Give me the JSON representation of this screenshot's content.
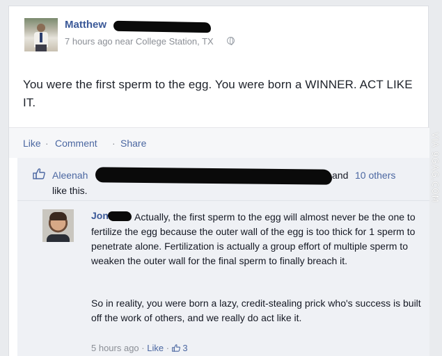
{
  "post": {
    "author": "Matthew",
    "time": "7 hours ago near College Station, TX",
    "text": "You were the first sperm to the egg. You were born a WINNER. ACT LIKE IT."
  },
  "actions": {
    "like": "Like",
    "comment": "Comment",
    "share": "Share",
    "separator": "·"
  },
  "likes": {
    "name": "Aleenah",
    "and": "and",
    "others": "10 others",
    "suffix": "like this."
  },
  "comment": {
    "author": "Jon",
    "text": "Actually, the first sperm to the egg will almost never be the one to fertilize the egg because the outer wall of the egg is too thick for 1 sperm to penetrate alone. Fertilization is actually a group effort of multiple sperm to weaken the outer wall for the final sperm to finally breach it.",
    "text2": "So in reality, you were born a lazy, credit-stealing prick who's success is built off the work of others, and we really do act like it.",
    "time": "5 hours ago",
    "like": "Like",
    "like_count": "3",
    "separator": "·"
  },
  "watermark": "VIA 9GAG.COM",
  "icons": [
    "globe-icon",
    "thumbs-up-icon"
  ],
  "colors": {
    "link": "#3b5998",
    "meta": "#8b8f96",
    "ufi_bg": "#eff1f5"
  }
}
